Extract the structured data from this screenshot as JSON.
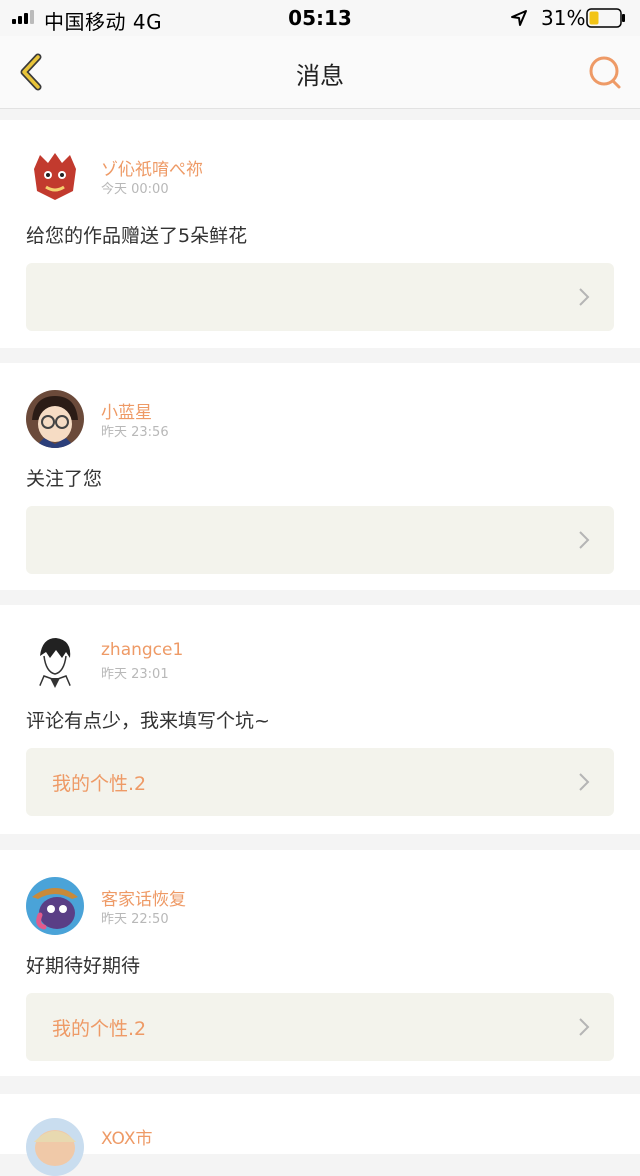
{
  "status_bar": {
    "carrier": "中国移动  4G",
    "time": "05:13",
    "battery_percent": "31%",
    "battery_level": 0.31,
    "icons": [
      "signal-icon",
      "location-arrow-icon",
      "battery-icon"
    ]
  },
  "nav": {
    "title": "消息",
    "back_icon": "chevron-left-icon",
    "search_icon": "search-icon"
  },
  "colors": {
    "accent": "#ee9a66",
    "back_arrow": "#e8c43a",
    "work_box_bg": "#f3f3ec",
    "page_bg": "#f4f4f4"
  },
  "messages": [
    {
      "username": "ゾ伈祇唷ぺ祢",
      "time": "今天 00:00",
      "text": "给您的作品赠送了5朵鲜花",
      "work_title": ""
    },
    {
      "username": "小蓝星",
      "time": "昨天 23:56",
      "text": "关注了您",
      "work_title": ""
    },
    {
      "username": "zhangce1",
      "time": "昨天 23:01",
      "text": "评论有点少，我来填写个坑~",
      "work_title": "我的个性.2"
    },
    {
      "username": "客家话恢复",
      "time": "昨天 22:50",
      "text": "好期待好期待",
      "work_title": "我的个性.2"
    },
    {
      "username": "XOX市",
      "time": "",
      "text": "",
      "work_title": ""
    }
  ]
}
